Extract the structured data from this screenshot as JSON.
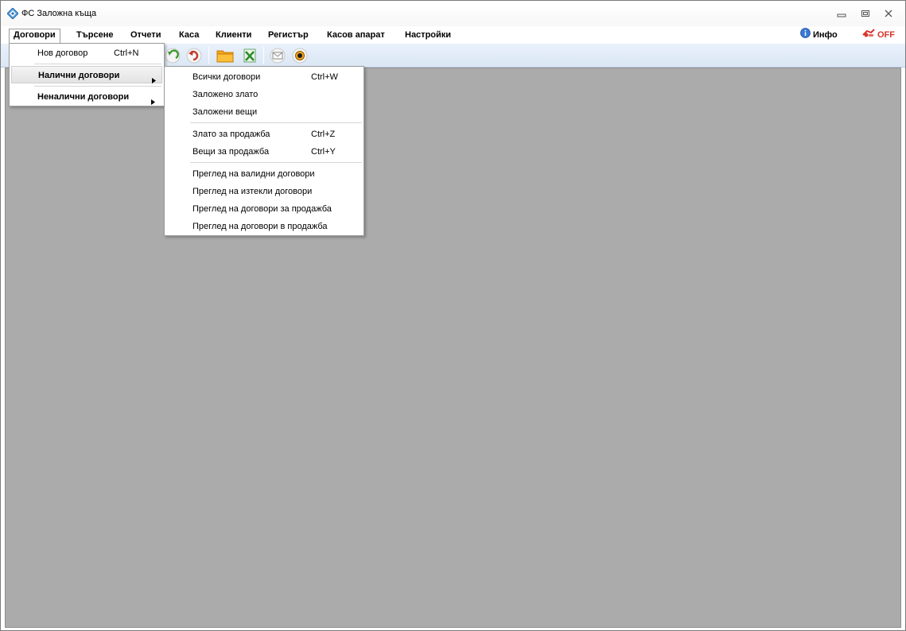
{
  "window": {
    "title": "ФС Заложна къща",
    "controls": [
      "minimize-icon",
      "restore-icon",
      "close-icon"
    ]
  },
  "menubar": {
    "items": [
      {
        "label": "Договори"
      },
      {
        "label": "Търсене"
      },
      {
        "label": "Отчети"
      },
      {
        "label": "Каса"
      },
      {
        "label": "Клиенти"
      },
      {
        "label": "Регистър"
      },
      {
        "label": "Касов апарат"
      },
      {
        "label": "Настройки"
      }
    ],
    "info_label": "Инфо",
    "off_label": "OFF"
  },
  "toolbar": {
    "buttons": [
      "back-icon",
      "undo-icon",
      "folder-icon",
      "excel-icon",
      "mail-icon",
      "eye-icon"
    ]
  },
  "dropdown": {
    "items": [
      {
        "label": "Нов договор",
        "shortcut": "Ctrl+N"
      },
      {
        "label": "Налични договори"
      },
      {
        "label": "Неналични договори"
      }
    ]
  },
  "submenu": {
    "items": [
      {
        "label": "Всички договори",
        "shortcut": "Ctrl+W"
      },
      {
        "label": "Заложено злато",
        "shortcut": ""
      },
      {
        "label": "Заложени вещи",
        "shortcut": ""
      },
      {
        "label": "Злато за продажба",
        "shortcut": "Ctrl+Z"
      },
      {
        "label": "Вещи за продажба",
        "shortcut": "Ctrl+Y"
      },
      {
        "label": "Преглед на валидни договори",
        "shortcut": ""
      },
      {
        "label": "Преглед на изтекли договори",
        "shortcut": ""
      },
      {
        "label": "Преглед на договори за продажба",
        "shortcut": ""
      },
      {
        "label": "Преглед на договори в продажба",
        "shortcut": ""
      }
    ]
  },
  "colors": {
    "workspace": "#ababab",
    "toolbar": "#dbe7f5",
    "off_red": "#d8322b",
    "info_blue": "#3a78d4"
  }
}
